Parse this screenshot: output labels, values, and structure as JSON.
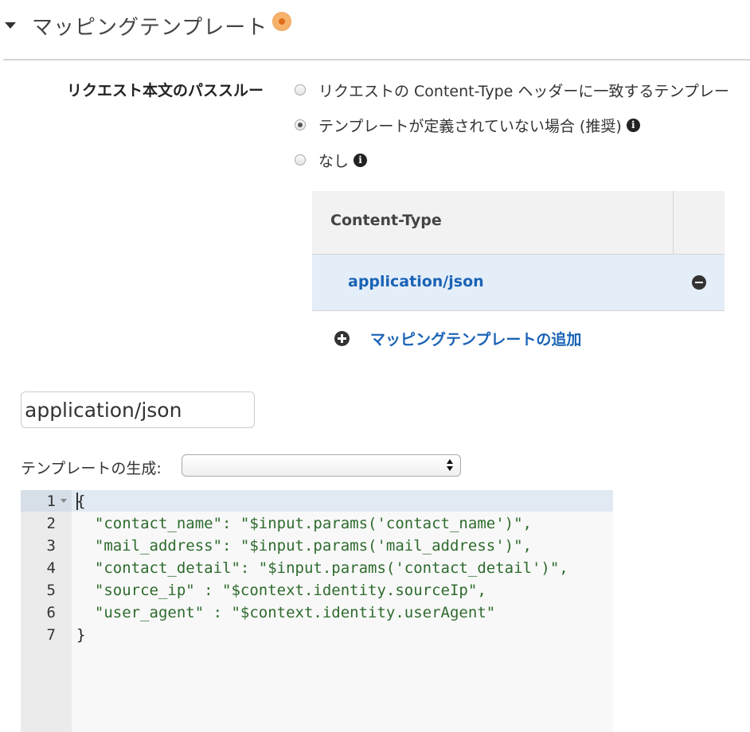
{
  "section": {
    "title": "マッピングテンプレート"
  },
  "passthrough": {
    "label": "リクエスト本文のパススルー",
    "options": [
      {
        "label": "リクエストの Content-Type ヘッダーに一致するテンプレー",
        "selected": false,
        "info": false
      },
      {
        "label": "テンプレートが定義されていない場合 (推奨)",
        "selected": true,
        "info": true
      },
      {
        "label": "なし",
        "selected": false,
        "info": true
      }
    ]
  },
  "content_type_table": {
    "header": "Content-Type",
    "rows": [
      "application/json"
    ]
  },
  "add_template_label": "マッピングテンプレートの追加",
  "content_type_input": {
    "value": "application/json"
  },
  "generate_template": {
    "label": "テンプレートの生成:",
    "selected": ""
  },
  "editor": {
    "line_numbers": [
      "1",
      "2",
      "3",
      "4",
      "5",
      "6",
      "7"
    ],
    "lines": [
      "{",
      "  \"contact_name\": \"$input.params('contact_name')\",",
      "  \"mail_address\": \"$input.params('mail_address')\",",
      "  \"contact_detail\": \"$input.params('contact_detail')\",",
      "  \"source_ip\" : \"$context.identity.sourceIp\",",
      "  \"user_agent\" : \"$context.identity.userAgent\"",
      "}"
    ]
  },
  "colors": {
    "link": "#1a63b5",
    "row_highlight": "#e4eef9",
    "string": "#2e6b2e",
    "status_dot": "#e06d18"
  }
}
